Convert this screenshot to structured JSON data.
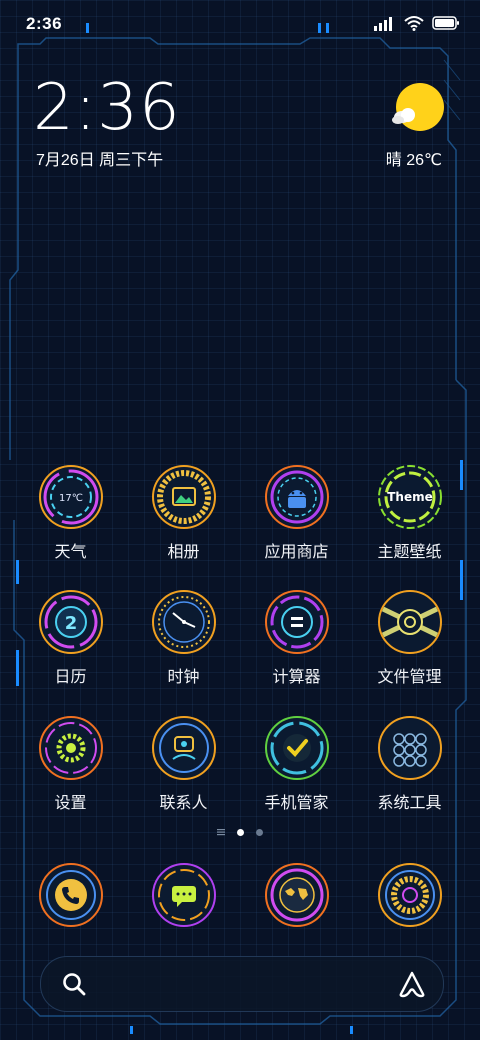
{
  "status_bar": {
    "time": "2:36"
  },
  "clock_widget": {
    "time": "2:36",
    "date": "7月26日 周三下午"
  },
  "weather_widget": {
    "condition": "晴",
    "temperature": "26℃",
    "text": "晴 26℃",
    "icon": "sun-cloud-icon"
  },
  "apps": [
    {
      "label": "天气",
      "icon": "weather-icon",
      "inner_text": "17℃",
      "ring_color": "#d04cf0"
    },
    {
      "label": "相册",
      "icon": "gallery-icon",
      "ring_color": "#f0a020"
    },
    {
      "label": "应用商店",
      "icon": "android-icon",
      "ring_color": "#b040f0"
    },
    {
      "label": "主题壁纸",
      "icon": "theme-icon",
      "inner_text": "Theme",
      "ring_color": "#8ae030"
    },
    {
      "label": "日历",
      "icon": "calendar-icon",
      "inner_text": "2",
      "ring_color": "#d04cf0"
    },
    {
      "label": "时钟",
      "icon": "clock-icon",
      "ring_color": "#f0a020"
    },
    {
      "label": "计算器",
      "icon": "calculator-icon",
      "ring_color": "#f07020"
    },
    {
      "label": "文件管理",
      "icon": "folder-icon",
      "ring_color": "#e8e070"
    },
    {
      "label": "设置",
      "icon": "gear-icon",
      "ring_color": "#f07020"
    },
    {
      "label": "联系人",
      "icon": "contacts-icon",
      "ring_color": "#f0a020"
    },
    {
      "label": "手机管家",
      "icon": "security-icon",
      "ring_color": "#60d040"
    },
    {
      "label": "系统工具",
      "icon": "tools-icon",
      "ring_color": "#f0a020"
    }
  ],
  "dock": [
    {
      "name": "phone",
      "icon": "phone-icon",
      "ring_color": "#f07020"
    },
    {
      "name": "messages",
      "icon": "message-icon",
      "ring_color": "#b040f0"
    },
    {
      "name": "browser",
      "icon": "globe-icon",
      "ring_color": "#d04cf0"
    },
    {
      "name": "music",
      "icon": "music-icon",
      "ring_color": "#f0a020"
    }
  ],
  "page_indicator": {
    "pages": 2,
    "current": 1
  },
  "search_bar": {
    "search_icon": "search-icon",
    "assistant_icon": "assistant-icon"
  },
  "colors": {
    "background": "#081226",
    "accent": "#1a8cff",
    "text": "#ffffff"
  }
}
